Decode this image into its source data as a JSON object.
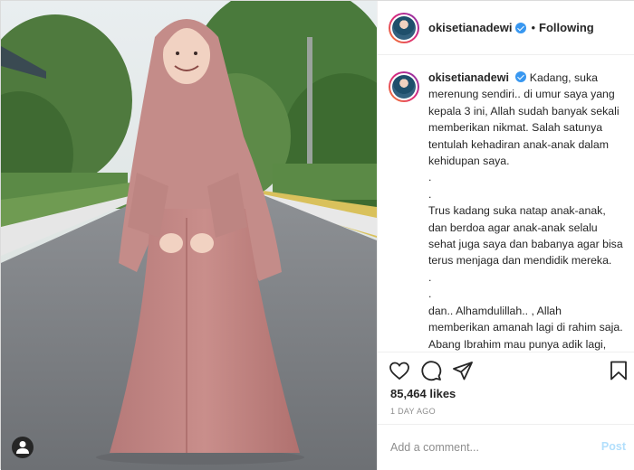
{
  "header": {
    "username": "okisetianadewi",
    "separator": "•",
    "follow_state": "Following"
  },
  "caption": {
    "username": "okisetianadewi",
    "text": "Kadang, suka merenung sendiri.. di umur saya yang kepala 3 ini, Allah sudah banyak sekali memberikan nikmat. Salah satunya tentulah kehadiran anak-anak dalam kehidupan saya.\n.\n.\nTrus kadang suka natap anak-anak, dan berdoa agar anak-anak selalu sehat juga saya dan babanya agar bisa terus menjaga dan mendidik mereka.\n.\n.\ndan.. Alhamdulillah.. , Allah memberikan amanah lagi di rahim saja. Abang Ibrahim mau punya adik lagi, insyaAllah. Fabiayyi aala irobbikuma tukadziban.."
  },
  "stats": {
    "likes": "85,464 likes",
    "posted": "1 DAY AGO"
  },
  "comment": {
    "placeholder": "Add a comment...",
    "post_label": "Post"
  },
  "icons": {
    "like": "heart-icon",
    "comment": "comment-icon",
    "share": "share-icon",
    "save": "bookmark-icon",
    "tag": "user-tag-icon",
    "verified": "verified-badge-icon"
  },
  "colors": {
    "verified": "#3897f0",
    "post_disabled": "#b2dffc",
    "dress": "#c08585"
  }
}
